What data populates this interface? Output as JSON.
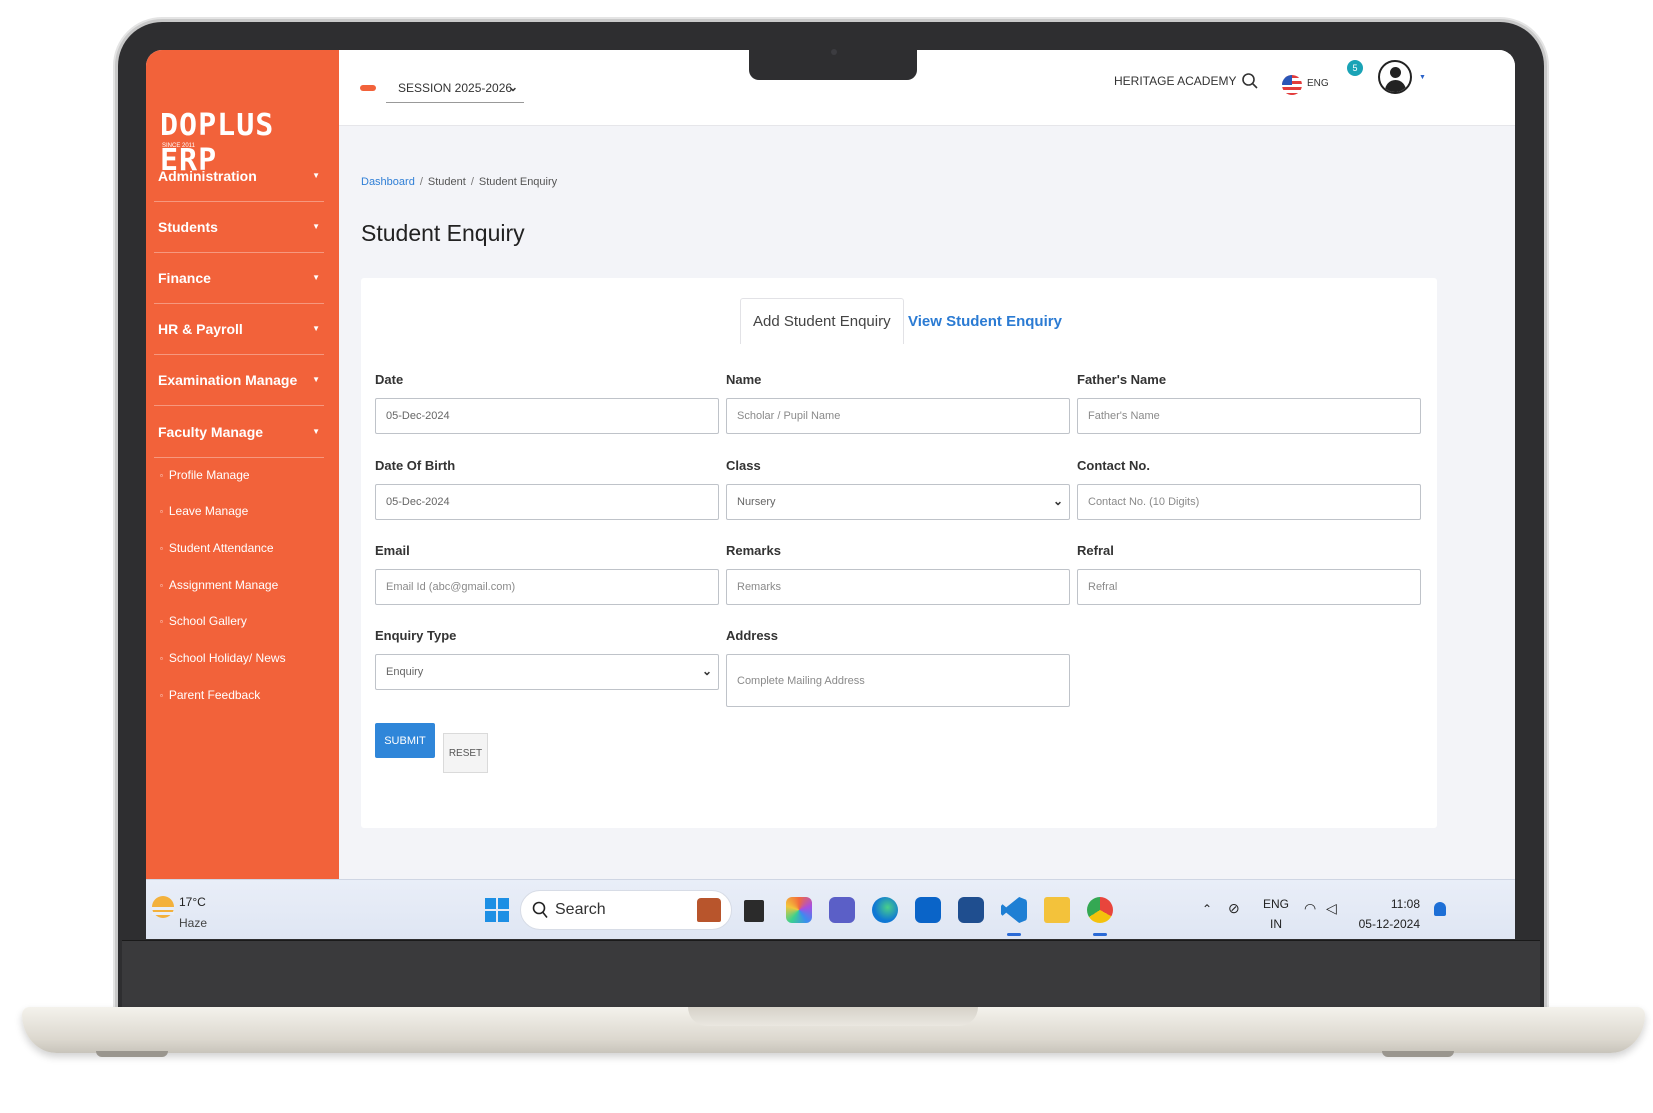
{
  "sidebar": {
    "logo": "DOPLUS ERP",
    "logo_tagline": "SINCE 2011",
    "menu": [
      {
        "label": "Administration"
      },
      {
        "label": "Students"
      },
      {
        "label": "Finance"
      },
      {
        "label": "HR & Payroll"
      },
      {
        "label": "Examination Manage"
      },
      {
        "label": "Faculty Manage"
      }
    ],
    "submenu": [
      {
        "label": "Profile Manage"
      },
      {
        "label": "Leave Manage"
      },
      {
        "label": "Student Attendance"
      },
      {
        "label": "Assignment Manage"
      },
      {
        "label": "School Gallery"
      },
      {
        "label": "School Holiday/ News"
      },
      {
        "label": "Parent Feedback"
      }
    ]
  },
  "header": {
    "session": "SESSION 2025-2026",
    "school": "HERITAGE ACADEMY",
    "language": "ENG",
    "notification_count": "5"
  },
  "breadcrumb": [
    "Dashboard",
    "Student",
    "Student Enquiry"
  ],
  "page_title": "Student Enquiry",
  "tabs": {
    "add": "Add Student Enquiry",
    "view": "View Student Enquiry"
  },
  "form": {
    "date": {
      "label": "Date",
      "value": "05-Dec-2024"
    },
    "name": {
      "label": "Name",
      "placeholder": "Scholar / Pupil Name"
    },
    "father_name": {
      "label": "Father's Name",
      "placeholder": "Father's Name"
    },
    "dob": {
      "label": "Date Of Birth",
      "value": "05-Dec-2024"
    },
    "class": {
      "label": "Class",
      "value": "Nursery"
    },
    "contact": {
      "label": "Contact No.",
      "placeholder": "Contact No. (10 Digits)"
    },
    "email": {
      "label": "Email",
      "placeholder": "Email Id (abc@gmail.com)"
    },
    "remarks": {
      "label": "Remarks",
      "placeholder": "Remarks"
    },
    "refral": {
      "label": "Refral",
      "placeholder": "Refral"
    },
    "enquiry_type": {
      "label": "Enquiry Type",
      "value": "Enquiry"
    },
    "address": {
      "label": "Address",
      "placeholder": "Complete Mailing Address"
    },
    "submit": "SUBMIT",
    "reset": "RESET"
  },
  "taskbar": {
    "temperature": "17°C",
    "weather": "Haze",
    "search": "Search",
    "lang_top": "ENG",
    "lang_bottom": "IN",
    "time": "11:08",
    "date": "05-12-2024"
  },
  "colors": {
    "sidebar": "#f2623a",
    "accent_blue": "#2f86d9",
    "tab_link": "#2b7bd3"
  }
}
